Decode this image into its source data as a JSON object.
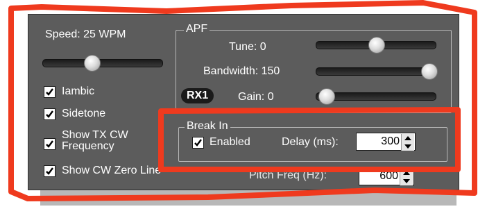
{
  "speed_label": "Speed:  25 WPM",
  "speed_value": 25,
  "checkboxes": [
    {
      "label": "Iambic",
      "checked": true
    },
    {
      "label": "Sidetone",
      "checked": true
    },
    {
      "label": "Show TX CW\nFrequency",
      "checked": true
    },
    {
      "label": "Show CW Zero Line",
      "checked": true
    }
  ],
  "apf": {
    "title": "APF",
    "tune_label": "Tune:  0",
    "tune_value": 0,
    "bandwidth_label": "Bandwidth:  150",
    "bandwidth_value": 150,
    "rx_badge": "RX1",
    "gain_label": "Gain:  0",
    "gain_value": 0
  },
  "break_in": {
    "title": "Break In",
    "enabled_label": "Enabled",
    "enabled_checked": true,
    "delay_label": "Delay (ms):",
    "delay_value": "300"
  },
  "pitch": {
    "label": "Pitch Freq (Hz):",
    "value": "600"
  },
  "colors": {
    "panel_bg": "#5c5c5c",
    "highlight_red": "#ef3a1e"
  },
  "icons": {
    "check": "check-icon",
    "spin_up": "arrow-up-icon",
    "spin_down": "arrow-down-icon"
  }
}
